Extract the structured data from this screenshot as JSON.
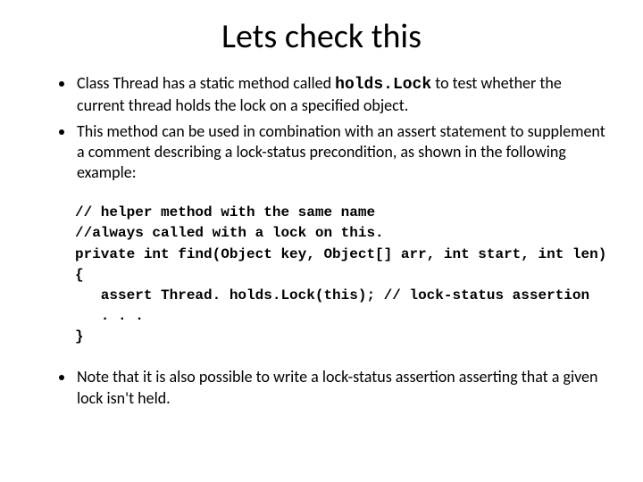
{
  "title": "Lets check this",
  "bullets": {
    "b1_pre": "Class Thread has a static method called ",
    "b1_code": "holds.Lock",
    "b1_post": " to test whether the current thread holds the lock on a specified object.",
    "b2": "This method can be used in combination with an assert statement to supplement a comment describing a lock-status precondition, as shown in the following example:",
    "b3": "Note that it is also possible to write a lock-status assertion asserting that a given lock isn't held."
  },
  "code": {
    "l1": "// helper method with the same name",
    "l2": "//always called with a lock on this.",
    "l3": "private int find(Object key, Object[] arr, int start, int len)",
    "l4": "{",
    "l5": "   assert Thread. holds.Lock(this); // lock-status assertion",
    "l6": "   . . .",
    "l7": "}"
  }
}
